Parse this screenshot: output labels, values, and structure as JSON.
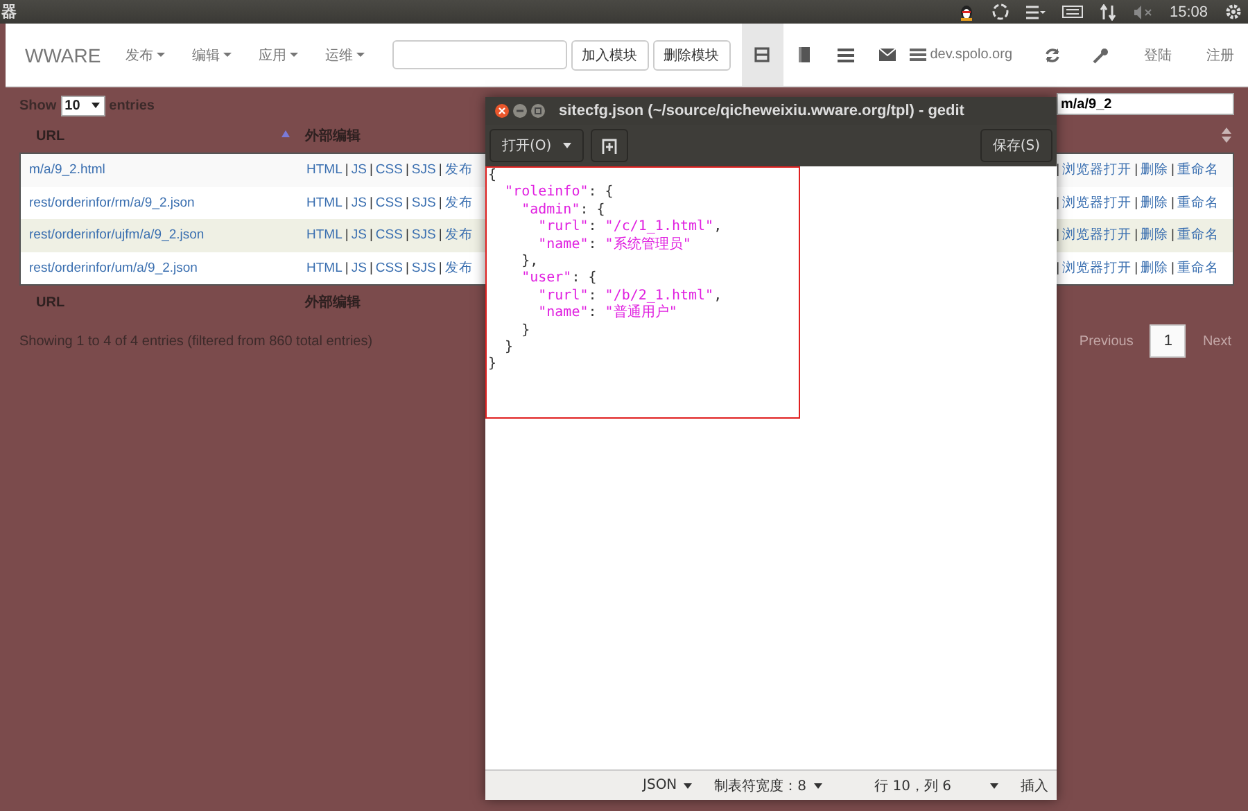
{
  "top_panel": {
    "app_title": "器",
    "clock": "15:08"
  },
  "navbar": {
    "brand": "WWARE",
    "menus": [
      {
        "label": "发布"
      },
      {
        "label": "编辑"
      },
      {
        "label": "应用"
      },
      {
        "label": "运维"
      }
    ],
    "module_buttons": [
      "加入模块",
      "删除模块"
    ],
    "view_tabs": [
      {
        "kind": "layout",
        "selected": true
      },
      {
        "kind": "book",
        "selected": false
      },
      {
        "kind": "list",
        "selected": false
      },
      {
        "kind": "mail",
        "selected": false
      }
    ],
    "server": "dev.spolo.org",
    "auth_links": [
      "登陆",
      "注册"
    ]
  },
  "length_control": {
    "before": "Show",
    "value": "10",
    "after": "entries"
  },
  "search": {
    "value": "m/a/9_2"
  },
  "table": {
    "columns": [
      "URL",
      "外部编辑"
    ],
    "rows": [
      {
        "url": "m/a/9_2.html",
        "edit_links": [
          "HTML",
          "JS",
          "CSS",
          "SJS",
          "发布"
        ],
        "more_links": [
          "浏览器打开",
          "删除",
          "重命名"
        ],
        "hovered": false
      },
      {
        "url": "rest/orderinfor/rm/a/9_2.json",
        "edit_links": [
          "HTML",
          "JS",
          "CSS",
          "SJS",
          "发布"
        ],
        "more_links": [
          "浏览器打开",
          "删除",
          "重命名"
        ],
        "hovered": false
      },
      {
        "url": "rest/orderinfor/ujfm/a/9_2.json",
        "edit_links": [
          "HTML",
          "JS",
          "CSS",
          "SJS",
          "发布"
        ],
        "more_links": [
          "浏览器打开",
          "删除",
          "重命名"
        ],
        "hovered": true
      },
      {
        "url": "rest/orderinfor/um/a/9_2.json",
        "edit_links": [
          "HTML",
          "JS",
          "CSS",
          "SJS",
          "发布"
        ],
        "more_links": [
          "浏览器打开",
          "删除",
          "重命名"
        ],
        "hovered": false
      }
    ],
    "link_separator": "|",
    "footer_columns": [
      "URL",
      "外部编辑"
    ],
    "info": "Showing 1 to 4 of 4 entries (filtered from 860 total entries)",
    "pagination": {
      "previous": "Previous",
      "pages": [
        {
          "label": "1",
          "selected": true
        }
      ],
      "next": "Next"
    }
  },
  "editor_window": {
    "title": "sitecfg.json (~/source/qicheweixiu.wware.org/tpl) - gedit",
    "open_button": "打开(O)",
    "save_button": "保存(S)",
    "lines": [
      [
        {
          "kind": "punct",
          "text": "{"
        }
      ],
      [
        {
          "kind": "string",
          "text": "  \"roleinfo\""
        },
        {
          "kind": "punct",
          "text": ": {"
        }
      ],
      [
        {
          "kind": "string",
          "text": "    \"admin\""
        },
        {
          "kind": "punct",
          "text": ": {"
        }
      ],
      [
        {
          "kind": "string",
          "text": "      \"rurl\""
        },
        {
          "kind": "punct",
          "text": ": "
        },
        {
          "kind": "string",
          "text": "\"/c/1_1.html\""
        },
        {
          "kind": "punct",
          "text": ","
        }
      ],
      [
        {
          "kind": "string",
          "text": "      \"name\""
        },
        {
          "kind": "punct",
          "text": ": "
        },
        {
          "kind": "string",
          "text": "\"系统管理员\""
        }
      ],
      [
        {
          "kind": "punct",
          "text": "    },"
        }
      ],
      [
        {
          "kind": "string",
          "text": "    \"user\""
        },
        {
          "kind": "punct",
          "text": ": {"
        }
      ],
      [
        {
          "kind": "string",
          "text": "      \"rurl\""
        },
        {
          "kind": "punct",
          "text": ": "
        },
        {
          "kind": "string",
          "text": "\"/b/2_1.html\""
        },
        {
          "kind": "punct",
          "text": ","
        }
      ],
      [
        {
          "kind": "string",
          "text": "      \"name\""
        },
        {
          "kind": "punct",
          "text": ": "
        },
        {
          "kind": "string",
          "text": "\"普通用户\""
        }
      ],
      [
        {
          "kind": "punct",
          "text": "    }"
        }
      ],
      [
        {
          "kind": "punct",
          "text": "  }"
        }
      ],
      [
        {
          "kind": "punct",
          "text": "}"
        }
      ]
    ],
    "status": {
      "language": "JSON",
      "tab_width": "制表符宽度：8",
      "position": "行 10，列 6",
      "mode": "插入"
    }
  }
}
